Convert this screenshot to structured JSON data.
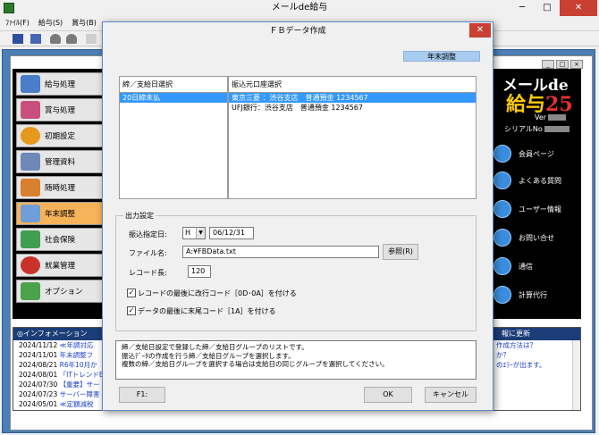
{
  "main_window": {
    "title": "メールde給与",
    "controls": [
      "─",
      "□",
      "✕"
    ],
    "menu": [
      "ﾌｧｲﾙ(F)",
      "給与(S)",
      "賞与(B)"
    ]
  },
  "left_menu": [
    {
      "label": "給与処理"
    },
    {
      "label": "賞与処理"
    },
    {
      "label": "初期設定"
    },
    {
      "label": "管理資料"
    },
    {
      "label": "随時処理"
    },
    {
      "label": "年末調整",
      "active": true
    },
    {
      "label": "社会保険"
    },
    {
      "label": "就業管理"
    },
    {
      "label": "オプション"
    }
  ],
  "right_panel": {
    "logo_line1": "メールde",
    "logo_line2": "給与",
    "logo_number": "25",
    "ver_label": "Ver",
    "serial_label": "シリアルNo",
    "items": [
      {
        "label": "会員ページ"
      },
      {
        "label": "よくある質問"
      },
      {
        "label": "ユーザー情報"
      },
      {
        "label": "お問い合せ"
      },
      {
        "label": "通信"
      },
      {
        "label": "計算代行"
      }
    ]
  },
  "info_panel": {
    "title": "◎インフォメーション",
    "rows": [
      {
        "date": "2024/11/12",
        "text": "≪年調対応"
      },
      {
        "date": "2024/11/01",
        "text": "年末調整フ"
      },
      {
        "date": "2024/08/21",
        "text": "R6年10月か"
      },
      {
        "date": "2024/08/01",
        "text": "「ITトレンドE"
      },
      {
        "date": "2024/07/30",
        "text": "【重要】サー"
      },
      {
        "date": "2024/07/23",
        "text": "サーバー障害"
      },
      {
        "date": "2024/05/01",
        "text": "≪定額減税"
      }
    ]
  },
  "update_panel": {
    "title": "報に更新",
    "rows": [
      "",
      "作成方法は？",
      "か？",
      "",
      "",
      "",
      "のｴﾗｰが出ます。"
    ]
  },
  "dialog": {
    "title": "ＦＢデータ作成",
    "close": "✕",
    "badge": "年末調整",
    "list_left_header": "締／支給日選択",
    "list_left_items": [
      "20日締末払"
    ],
    "list_right_header": "振込元口座選択",
    "list_right_items": [
      "東京三菱 ：渋谷支店　普通預金 1234567",
      "UFJ銀行：渋谷支店　普通預金 1234567"
    ],
    "output_group": "出力設定",
    "transfer_date_label": "振込指定日:",
    "era_value": "H",
    "date_value": "06/12/31",
    "filename_label": "ファイル名:",
    "filename_value": "A:¥FBData.txt",
    "browse_button": "参照(R)",
    "record_len_label": "レコード長:",
    "record_len_value": "120",
    "check1_label": "レコードの最後に改行コード［0D･0A］を付ける",
    "check2_label": "データの最後に末尾コード［1A］を付ける",
    "check_mark": "✓",
    "message_lines": [
      "締／支給日設定で登録した締／支給日グループのリストです。",
      "振込ﾃﾞｰﾀの作成を行う締／支給日グループを選択します。",
      "複数の締／支給日グループを選択する場合は支給日の同じグループを選択してください。"
    ],
    "f1_button": "F1:",
    "ok_button": "OK",
    "cancel_button": "キャンセル"
  },
  "colors": {
    "selection": "#3399ff",
    "mdi_background": "#4b7fb6",
    "close_red": "#c84031",
    "active_menu": "#f7b35a",
    "info_header": "#1c3d78",
    "link_blue": "#1a3fd0"
  }
}
